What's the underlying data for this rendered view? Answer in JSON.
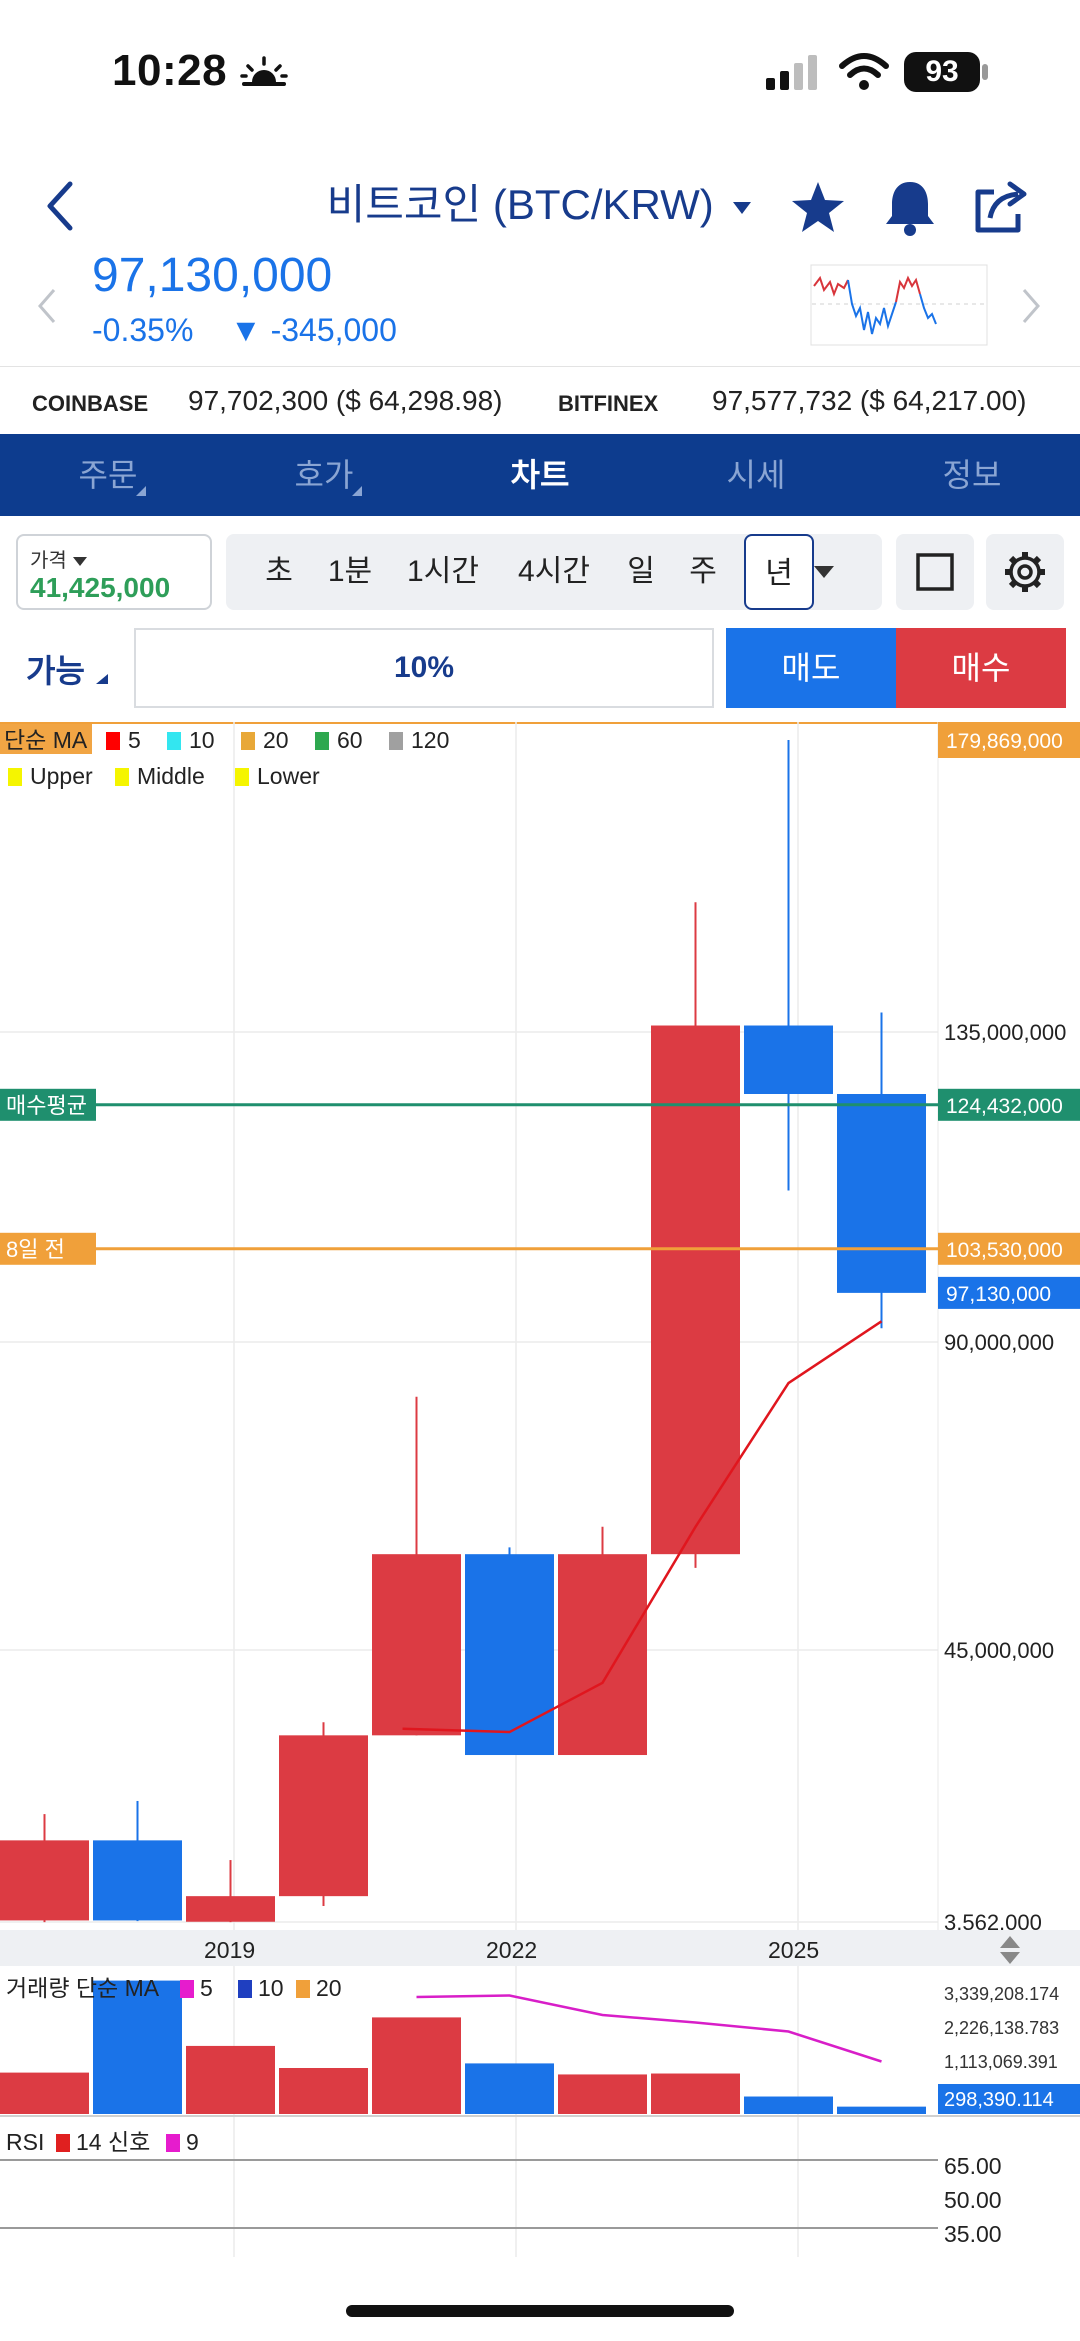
{
  "status_bar": {
    "time": "10:28",
    "battery": "93"
  },
  "header": {
    "title": "비트코인 (BTC/KRW)"
  },
  "ticker": {
    "price": "97,130,000",
    "change_pct": "-0.35%",
    "change_abs": "▼ -345,000"
  },
  "exchanges": [
    {
      "name": "COINBASE",
      "value": "97,702,300 ($ 64,298.98)"
    },
    {
      "name": "BITFINEX",
      "value": "97,577,732 ($ 64,217.00)"
    }
  ],
  "tabs": [
    {
      "label": "주문",
      "active": false,
      "corner": true
    },
    {
      "label": "호가",
      "active": false,
      "corner": true
    },
    {
      "label": "차트",
      "active": true,
      "corner": false
    },
    {
      "label": "시세",
      "active": false,
      "corner": false
    },
    {
      "label": "정보",
      "active": false,
      "corner": false
    }
  ],
  "toolbar": {
    "price_label": "가격",
    "price_value": "41,425,000",
    "timeframes": [
      "초",
      "1분",
      "1시간",
      "4시간",
      "일",
      "주",
      "년"
    ],
    "active_timeframe": "년"
  },
  "order": {
    "available_label": "가능",
    "percent": "10%",
    "sell_label": "매도",
    "buy_label": "매수"
  },
  "chart_data": {
    "type": "candlestick",
    "x_ticks": [
      "2019",
      "2022",
      "2025"
    ],
    "y_ticks": [
      {
        "value": 3562000,
        "label": "3,562,000"
      },
      {
        "value": 45000000,
        "label": "45,000,000"
      },
      {
        "value": 90000000,
        "label": "90,000,000"
      },
      {
        "value": 135000000,
        "label": "135,000,000"
      }
    ],
    "legend_ma": {
      "label": "단순 MA",
      "items": [
        {
          "name": "5",
          "color": "#ff0000"
        },
        {
          "name": "10",
          "color": "#33e6f0"
        },
        {
          "name": "20",
          "color": "#e8a838"
        },
        {
          "name": "60",
          "color": "#2ea84f"
        },
        {
          "name": "120",
          "color": "#a0a0a0"
        }
      ]
    },
    "legend_bb": {
      "items": [
        {
          "name": "Upper",
          "color": "#f5f500"
        },
        {
          "name": "Middle",
          "color": "#f5f500"
        },
        {
          "name": "Lower",
          "color": "#f5f500"
        }
      ]
    },
    "candles": [
      {
        "open": 3800000,
        "high": 20000000,
        "low": 3500000,
        "close": 16000000,
        "dir": "up"
      },
      {
        "open": 16000000,
        "high": 22000000,
        "low": 3700000,
        "close": 3800000,
        "dir": "down"
      },
      {
        "open": 3600000,
        "high": 13000000,
        "low": 3500000,
        "close": 7500000,
        "dir": "up"
      },
      {
        "open": 7500000,
        "high": 34000000,
        "low": 6000000,
        "close": 32000000,
        "dir": "up"
      },
      {
        "open": 32000000,
        "high": 82000000,
        "low": 32000000,
        "close": 59000000,
        "dir": "up"
      },
      {
        "open": 59000000,
        "high": 60000000,
        "low": 29000000,
        "close": 29000000,
        "dir": "down"
      },
      {
        "open": 29000000,
        "high": 63000000,
        "low": 29000000,
        "close": 59000000,
        "dir": "up"
      },
      {
        "open": 59000000,
        "high": 155000000,
        "low": 57000000,
        "close": 136000000,
        "dir": "up"
      },
      {
        "open": 136000000,
        "high": 180000000,
        "low": 112000000,
        "close": 126000000,
        "dir": "down"
      },
      {
        "open": 126000000,
        "high": 138000000,
        "low": 92000000,
        "close": 97130000,
        "dir": "down"
      }
    ],
    "ma_line": [
      {
        "i": 4.35,
        "v": 33000000
      },
      {
        "i": 5.5,
        "v": 32500000
      },
      {
        "i": 6.5,
        "v": 40000000
      },
      {
        "i": 7.5,
        "v": 63000000
      },
      {
        "i": 8.5,
        "v": 84000000
      },
      {
        "i": 9.5,
        "v": 93000000
      }
    ],
    "price_lines": [
      {
        "label": "매수평균",
        "value": 124432000,
        "value_label": "124,432,000",
        "color": "#1f8f6e"
      },
      {
        "label": "8일 전",
        "value": 103530000,
        "value_label": "103,530,000",
        "color": "#f0a03a"
      }
    ],
    "top_label": "179,869,000",
    "current_label": "97,130,000",
    "volume": {
      "label": "거래량 단순 MA",
      "legend": [
        {
          "name": "5",
          "color": "#e61ccd"
        },
        {
          "name": "10",
          "color": "#1f3fc0"
        },
        {
          "name": "20",
          "color": "#f0a03a"
        }
      ],
      "ticks": [
        "3,339,208.174",
        "2,226,138.783",
        "1,113,069.391"
      ],
      "current": "298,390.114",
      "bars": [
        {
          "v": 0.45,
          "dir": "up"
        },
        {
          "v": 1.45,
          "dir": "down"
        },
        {
          "v": 0.74,
          "dir": "up"
        },
        {
          "v": 0.5,
          "dir": "up"
        },
        {
          "v": 1.05,
          "dir": "up"
        },
        {
          "v": 0.55,
          "dir": "down"
        },
        {
          "v": 0.43,
          "dir": "up"
        },
        {
          "v": 0.44,
          "dir": "up"
        },
        {
          "v": 0.19,
          "dir": "down"
        },
        {
          "v": 0.08,
          "dir": "down"
        }
      ],
      "ma": [
        {
          "i": 4.5,
          "v": 0.78
        },
        {
          "i": 5.5,
          "v": 0.79
        },
        {
          "i": 6.5,
          "v": 0.66
        },
        {
          "i": 7.5,
          "v": 0.61
        },
        {
          "i": 8.5,
          "v": 0.55
        },
        {
          "i": 9.5,
          "v": 0.35
        }
      ]
    },
    "rsi": {
      "label": "RSI",
      "legend": [
        {
          "name": "14 신호",
          "color": "#e02020"
        },
        {
          "name": "9",
          "color": "#e61ccd"
        }
      ],
      "ticks": [
        "65.00",
        "50.00",
        "35.00"
      ]
    }
  }
}
